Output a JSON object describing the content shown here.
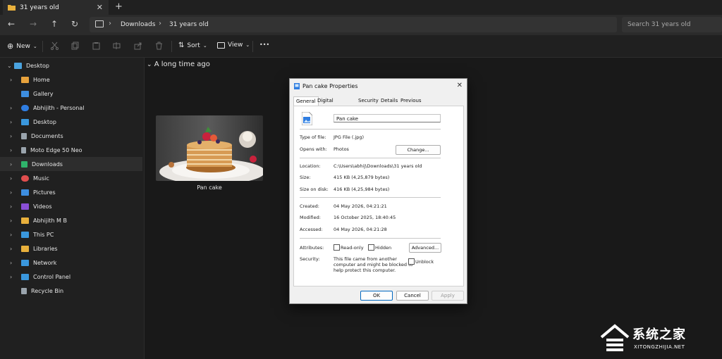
{
  "window": {
    "tab_title": "31 years old",
    "new_tab": "+",
    "close_tab": "✕"
  },
  "nav": {
    "breadcrumb": [
      "Downloads",
      "31 years old"
    ],
    "search_placeholder": "Search 31 years old"
  },
  "toolbar": {
    "new_label": "New",
    "sort_label": "Sort",
    "view_label": "View",
    "more_label": "•••"
  },
  "sidebar": {
    "items": [
      {
        "label": "Desktop",
        "expanded": true,
        "color": "#4aa3df"
      },
      {
        "label": "Home",
        "color": "#e8a23c"
      },
      {
        "label": "Gallery",
        "color": "#3d8ee0"
      },
      {
        "label": "Abhijith - Personal",
        "color": "#2f7de1"
      },
      {
        "label": "Desktop",
        "color": "#3a97dd"
      },
      {
        "label": "Documents",
        "color": "#9aa4ad"
      },
      {
        "label": "Moto Edge 50 Neo",
        "color": "#9aa4ad"
      },
      {
        "label": "Downloads",
        "color": "#2fb36b",
        "selected": true
      },
      {
        "label": "Music",
        "color": "#e04e4e"
      },
      {
        "label": "Pictures",
        "color": "#3d8ee0"
      },
      {
        "label": "Videos",
        "color": "#8a4fd6"
      },
      {
        "label": "Abhijith M B",
        "color": "#e8b03c"
      },
      {
        "label": "This PC",
        "color": "#3a97dd"
      },
      {
        "label": "Libraries",
        "color": "#e8b03c"
      },
      {
        "label": "Network",
        "color": "#3a97dd"
      },
      {
        "label": "Control Panel",
        "color": "#3a97dd"
      },
      {
        "label": "Recycle Bin",
        "color": "#9aa4ad"
      }
    ]
  },
  "content": {
    "group_label": "A long time ago",
    "file_name": "Pan cake"
  },
  "dialog": {
    "title": "Pan cake Properties",
    "tabs": [
      "General",
      "Digital Signatures",
      "Security",
      "Details",
      "Previous Versions"
    ],
    "file_name": "Pan cake",
    "type_label": "Type of file:",
    "type_value": "JPG File (.jpg)",
    "opens_label": "Opens with:",
    "opens_value": "Photos",
    "change_button": "Change...",
    "location_label": "Location:",
    "location_value": "C:\\Users\\abhij\\Downloads\\31 years old",
    "size_label": "Size:",
    "size_value": "415 KB (4,25,879 bytes)",
    "disk_label": "Size on disk:",
    "disk_value": "416 KB (4,25,984 bytes)",
    "created_label": "Created:",
    "created_value": "04 May 2026, 04:21:21",
    "modified_label": "Modified:",
    "modified_value": "16 October 2025, 18:40:45",
    "accessed_label": "Accessed:",
    "accessed_value": "04 May 2026, 04:21:28",
    "attributes_label": "Attributes:",
    "readonly_label": "Read-only",
    "hidden_label": "Hidden",
    "advanced_button": "Advanced...",
    "security_label": "Security:",
    "security_text_1": "This file came from another",
    "security_text_2": "computer and might be blocked to",
    "security_text_3": "help protect this computer.",
    "unblock_label": "Unblock",
    "ok_button": "OK",
    "cancel_button": "Cancel",
    "apply_button": "Apply"
  },
  "watermark": {
    "text": "系统之家",
    "url": "XITONGZHIJIA.NET"
  }
}
